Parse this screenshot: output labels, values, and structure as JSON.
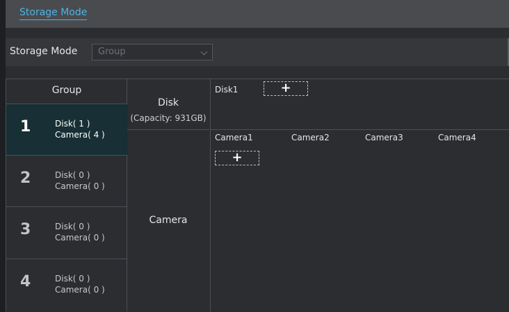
{
  "header": {
    "tab_label": "Storage Mode"
  },
  "filter": {
    "label": "Storage Mode",
    "select_value": "Group"
  },
  "groups": {
    "header": "Group",
    "items": [
      {
        "num": "1",
        "disk": "Disk( 1 )",
        "camera": "Camera( 4 )",
        "active": true
      },
      {
        "num": "2",
        "disk": "Disk( 0 )",
        "camera": "Camera( 0 )",
        "active": false
      },
      {
        "num": "3",
        "disk": "Disk( 0 )",
        "camera": "Camera( 0 )",
        "active": false
      },
      {
        "num": "4",
        "disk": "Disk( 0 )",
        "camera": "Camera( 0 )",
        "active": false
      }
    ]
  },
  "middle": {
    "disk_title": "Disk",
    "disk_capacity": "(Capacity: 931GB)",
    "camera_title": "Camera"
  },
  "disks": {
    "items": [
      "Disk1"
    ],
    "add_glyph": "+"
  },
  "cameras": {
    "items": [
      "Camera1",
      "Camera2",
      "Camera3",
      "Camera4"
    ],
    "add_glyph": "+"
  },
  "colors": {
    "accent": "#4bb4e6",
    "active_row": "#172f35",
    "background": "#2b2d31"
  },
  "icons": {
    "add": "plus-icon",
    "dropdown": "chevron-down-icon"
  }
}
